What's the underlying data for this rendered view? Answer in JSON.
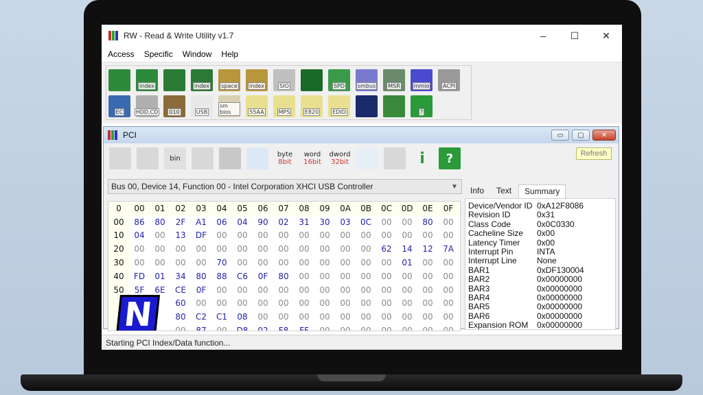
{
  "window": {
    "title": "RW - Read & Write Utility v1.7",
    "controls": [
      "–",
      "☐",
      "✕"
    ]
  },
  "menu": [
    "Access",
    "Specific",
    "Window",
    "Help"
  ],
  "toolbar": {
    "row1": [
      {
        "icon": "pci-card-icon",
        "label": "",
        "color": "#2d8a3a"
      },
      {
        "icon": "pci-index-icon",
        "label": "index",
        "color": "#2d8a3a"
      },
      {
        "icon": "memory-icon",
        "label": "",
        "color": "#2a7a35"
      },
      {
        "icon": "memory-index-icon",
        "label": "index",
        "color": "#2a7a35"
      },
      {
        "icon": "io-space-icon",
        "label": "space",
        "color": "#b8963c"
      },
      {
        "icon": "io-index-icon",
        "label": "index",
        "color": "#b8963c"
      },
      {
        "icon": "sio-icon",
        "label": "SIO",
        "color": "#c0c0c0"
      },
      {
        "icon": "waveform-icon",
        "label": "",
        "color": "#1a6a2a"
      },
      {
        "icon": "spd-icon",
        "label": "SPD",
        "color": "#3a9a4a"
      },
      {
        "icon": "smbus-icon",
        "label": "smbus",
        "color": "#7a7ad0"
      },
      {
        "icon": "msr-icon",
        "label": "MSR",
        "color": "#6a8a6a"
      },
      {
        "icon": "mmio-icon",
        "label": "mmio",
        "color": "#4a4ad0"
      },
      {
        "icon": "acpi-icon",
        "label": "ACPI",
        "color": "#9a9a9a"
      }
    ],
    "row2": [
      {
        "icon": "ec-icon",
        "label": "EC",
        "color": "#3a6ab0"
      },
      {
        "icon": "hdd-cd-icon",
        "label": "HDD,CD",
        "color": "#b0b0b0"
      },
      {
        "icon": "disk-010-icon",
        "label": "010",
        "color": "#8a6a3a"
      },
      {
        "icon": "usb-icon",
        "label": "USB",
        "color": "#e8e8e8"
      },
      {
        "icon": "smbios-icon",
        "label": "sm bios",
        "color": "#d8d0b0"
      },
      {
        "icon": "55aa-icon",
        "label": "55AA",
        "color": "#e8e090"
      },
      {
        "icon": "mps-icon",
        "label": "MPS",
        "color": "#e8e090"
      },
      {
        "icon": "e820-icon",
        "label": "E820",
        "color": "#e8e090"
      },
      {
        "icon": "edid-icon",
        "label": "EDID",
        "color": "#e8e090"
      },
      {
        "icon": "terminal-icon",
        "label": "",
        "color": "#1a2a6a"
      },
      {
        "icon": "device-icon",
        "label": "",
        "color": "#3a8a3a"
      },
      {
        "icon": "help-icon",
        "label": "?",
        "color": "#2a9a3a"
      }
    ]
  },
  "pci": {
    "title": "PCI",
    "refresh_label": "Refresh",
    "toolbar": [
      {
        "icon": "save-icon",
        "top": "",
        "bot": ""
      },
      {
        "icon": "multi-save-icon",
        "top": "",
        "bot": ""
      },
      {
        "icon": "bin-icon",
        "top": "bin",
        "bot": ""
      },
      {
        "icon": "save-to-file-icon",
        "top": "",
        "bot": ""
      },
      {
        "icon": "binoculars-icon",
        "top": "",
        "bot": ""
      },
      {
        "icon": "grid-view-icon",
        "top": "",
        "bot": ""
      },
      {
        "icon": "byte-8bit-icon",
        "top": "byte",
        "bot": "8bit"
      },
      {
        "icon": "word-16bit-icon",
        "top": "word",
        "bot": "16bit"
      },
      {
        "icon": "dword-32bit-icon",
        "top": "dword",
        "bot": "32bit"
      },
      {
        "icon": "list-view-icon",
        "top": "",
        "bot": ""
      },
      {
        "icon": "gear-icon",
        "top": "",
        "bot": ""
      },
      {
        "icon": "info-icon",
        "top": "i",
        "bot": ""
      },
      {
        "icon": "help-icon",
        "top": "?",
        "bot": ""
      }
    ],
    "device_select": "Bus 00, Device 14, Function 00 - Intel Corporation XHCI USB Controller",
    "hex_header": [
      "0",
      "00",
      "01",
      "02",
      "03",
      "04",
      "05",
      "06",
      "07",
      "08",
      "09",
      "0A",
      "0B",
      "0C",
      "0D",
      "0E",
      "0F"
    ],
    "hex_rows": [
      [
        "00",
        "86",
        "80",
        "2F",
        "A1",
        "06",
        "04",
        "90",
        "02",
        "31",
        "30",
        "03",
        "0C",
        "00",
        "00",
        "80",
        "00"
      ],
      [
        "10",
        "04",
        "00",
        "13",
        "DF",
        "00",
        "00",
        "00",
        "00",
        "00",
        "00",
        "00",
        "00",
        "00",
        "00",
        "00",
        "00"
      ],
      [
        "20",
        "00",
        "00",
        "00",
        "00",
        "00",
        "00",
        "00",
        "00",
        "00",
        "00",
        "00",
        "00",
        "62",
        "14",
        "12",
        "7A"
      ],
      [
        "30",
        "00",
        "00",
        "00",
        "00",
        "70",
        "00",
        "00",
        "00",
        "00",
        "00",
        "00",
        "00",
        "00",
        "01",
        "00",
        "00"
      ],
      [
        "40",
        "FD",
        "01",
        "34",
        "80",
        "88",
        "C6",
        "0F",
        "80",
        "00",
        "00",
        "00",
        "00",
        "00",
        "00",
        "00",
        "00"
      ],
      [
        "50",
        "5F",
        "6E",
        "CE",
        "0F",
        "00",
        "00",
        "00",
        "00",
        "00",
        "00",
        "00",
        "00",
        "00",
        "00",
        "00",
        "00"
      ],
      [
        "",
        "",
        "",
        "60",
        "00",
        "00",
        "00",
        "00",
        "00",
        "00",
        "00",
        "00",
        "00",
        "00",
        "00",
        "00",
        "00"
      ],
      [
        "",
        "",
        "",
        "80",
        "C2",
        "C1",
        "08",
        "00",
        "00",
        "00",
        "00",
        "00",
        "00",
        "00",
        "00",
        "00",
        "00"
      ],
      [
        "",
        "",
        "",
        "00",
        "87",
        "00",
        "D8",
        "02",
        "F8",
        "FF",
        "00",
        "00",
        "00",
        "00",
        "00",
        "00",
        "00"
      ]
    ],
    "logo": "N",
    "tabs": [
      "Info",
      "Text",
      "Summary"
    ],
    "summary": [
      {
        "k": "Device/Vendor ID",
        "v": "0xA12F8086"
      },
      {
        "k": "Revision ID",
        "v": "0x31"
      },
      {
        "k": "Class Code",
        "v": "0x0C0330"
      },
      {
        "k": "Cacheline Size",
        "v": "0x00"
      },
      {
        "k": "Latency Timer",
        "v": "0x00"
      },
      {
        "k": "Interrupt Pin",
        "v": "INTA"
      },
      {
        "k": "Interrupt Line",
        "v": "None"
      },
      {
        "k": "BAR1",
        "v": "0xDF130004"
      },
      {
        "k": "BAR2",
        "v": "0x00000000"
      },
      {
        "k": "BAR3",
        "v": "0x00000000"
      },
      {
        "k": "BAR4",
        "v": "0x00000000"
      },
      {
        "k": "BAR5",
        "v": "0x00000000"
      },
      {
        "k": "BAR6",
        "v": "0x00000000"
      },
      {
        "k": "Expansion ROM",
        "v": "0x00000000"
      }
    ]
  },
  "status": "Starting PCI Index/Data function..."
}
